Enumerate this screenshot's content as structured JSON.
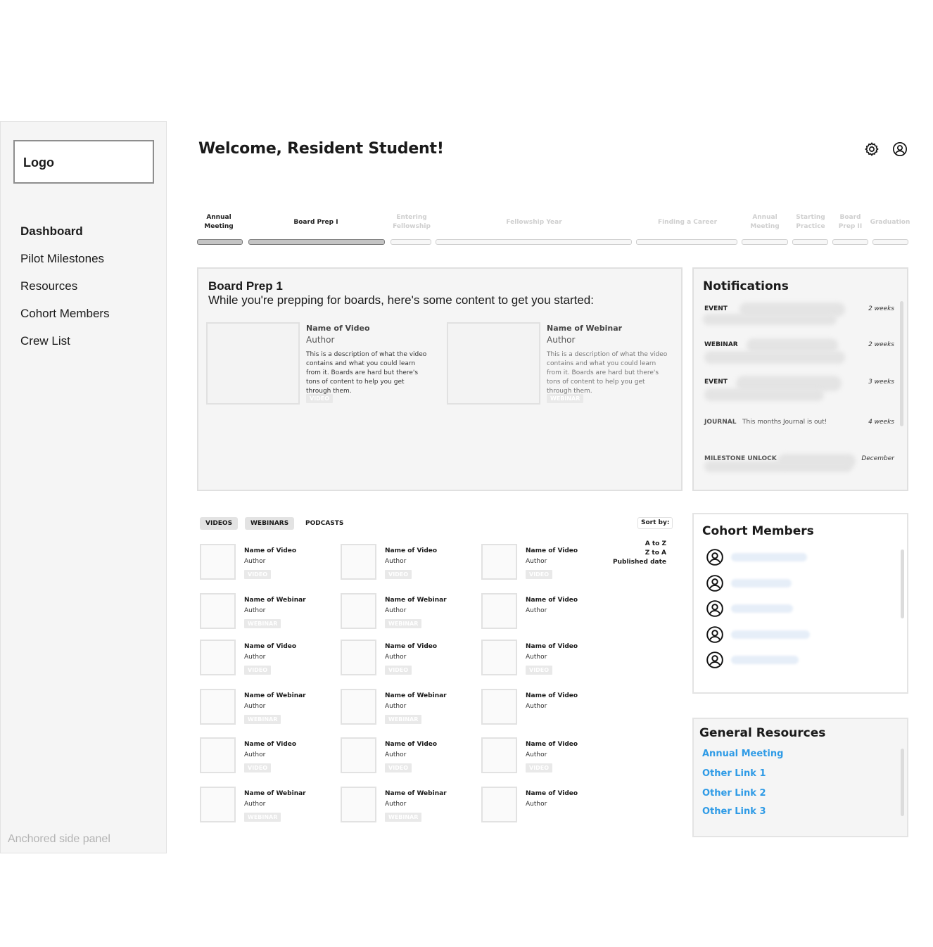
{
  "sidebar": {
    "logo": "Logo",
    "items": [
      {
        "label": "Dashboard"
      },
      {
        "label": "Pilot Milestones"
      },
      {
        "label": "Resources"
      },
      {
        "label": "Cohort Members"
      },
      {
        "label": "Crew List"
      }
    ],
    "caption": "Anchored side panel"
  },
  "header": {
    "welcome": "Welcome, Resident Student!",
    "icons": [
      "gear-icon",
      "user-circle-icon"
    ]
  },
  "milestones": [
    {
      "label": "Annual Meeting",
      "completed": true
    },
    {
      "label": "Board Prep I",
      "completed": true
    },
    {
      "label": "Entering Fellowship",
      "completed": false
    },
    {
      "label": "Fellowship Year",
      "completed": false
    },
    {
      "label": "Finding a Career",
      "completed": false
    },
    {
      "label": "Annual Meeting",
      "completed": false
    },
    {
      "label": "Starting Practice",
      "completed": false
    },
    {
      "label": "Board Prep II",
      "completed": false
    },
    {
      "label": "Graduation",
      "completed": false
    }
  ],
  "featured": {
    "title": "Board Prep 1",
    "subtitle": "While you're prepping for boards, here's some content to get you started:",
    "cards": [
      {
        "name": "Name of Video",
        "author": "Author",
        "description": "This is a description of what the video contains and what you could learn from it. Boards are hard but there's tons of content to help you get through them.",
        "tag": "VIDEO"
      },
      {
        "name": "Name of Webinar",
        "author": "Author",
        "description": "This is a description of what the video contains and what you could learn from it. Boards are hard but there's tons of content to help you get through them.",
        "tag": "WEBINAR"
      }
    ]
  },
  "notifications": {
    "title": "Notifications",
    "items": [
      {
        "type": "EVENT",
        "message": "",
        "time": "2 weeks"
      },
      {
        "type": "WEBINAR",
        "message": "",
        "time": "2 weeks"
      },
      {
        "type": "EVENT",
        "message": "",
        "time": "3 weeks"
      },
      {
        "type": "JOURNAL",
        "message": "This months Journal is out!",
        "time": "4 weeks"
      },
      {
        "type": "MILESTONE UNLOCK",
        "message": "",
        "time": "December"
      }
    ]
  },
  "library": {
    "tabs": [
      "VIDEOS",
      "WEBINARS",
      "PODCASTS"
    ],
    "sort": {
      "label": "Sort by:",
      "options": [
        "A to Z",
        "Z to A",
        "Published date"
      ]
    },
    "rows": [
      [
        {
          "name": "Name of Video",
          "author": "Author",
          "tag": "VIDEO"
        },
        {
          "name": "Name of Video",
          "author": "Author",
          "tag": "VIDEO"
        },
        {
          "name": "Name of Video",
          "author": "Author",
          "tag": "VIDEO"
        }
      ],
      [
        {
          "name": "Name of Webinar",
          "author": "Author",
          "tag": "WEBINAR"
        },
        {
          "name": "Name of Webinar",
          "author": "Author",
          "tag": "WEBINAR"
        },
        {
          "name": "Name of Video",
          "author": "Author",
          "tag": ""
        }
      ],
      [
        {
          "name": "Name of Video",
          "author": "Author",
          "tag": "VIDEO"
        },
        {
          "name": "Name of Video",
          "author": "Author",
          "tag": "VIDEO"
        },
        {
          "name": "Name of Video",
          "author": "Author",
          "tag": "VIDEO"
        }
      ],
      [
        {
          "name": "Name of Webinar",
          "author": "Author",
          "tag": "WEBINAR"
        },
        {
          "name": "Name of Webinar",
          "author": "Author",
          "tag": "WEBINAR"
        },
        {
          "name": "Name of Video",
          "author": "Author",
          "tag": ""
        }
      ],
      [
        {
          "name": "Name of Video",
          "author": "Author",
          "tag": "VIDEO"
        },
        {
          "name": "Name of Video",
          "author": "Author",
          "tag": "VIDEO"
        },
        {
          "name": "Name of Video",
          "author": "Author",
          "tag": "VIDEO"
        }
      ],
      [
        {
          "name": "Name of Webinar",
          "author": "Author",
          "tag": "WEBINAR"
        },
        {
          "name": "Name of Webinar",
          "author": "Author",
          "tag": "WEBINAR"
        },
        {
          "name": "Name of Video",
          "author": "Author",
          "tag": ""
        }
      ]
    ]
  },
  "cohort": {
    "title": "Cohort Members",
    "member_count": 5
  },
  "resources": {
    "title": "General Resources",
    "links": [
      "Annual Meeting",
      "Other Link 1",
      "Other Link 2",
      "Other Link 3"
    ],
    "link_color": "#2f9be6"
  }
}
